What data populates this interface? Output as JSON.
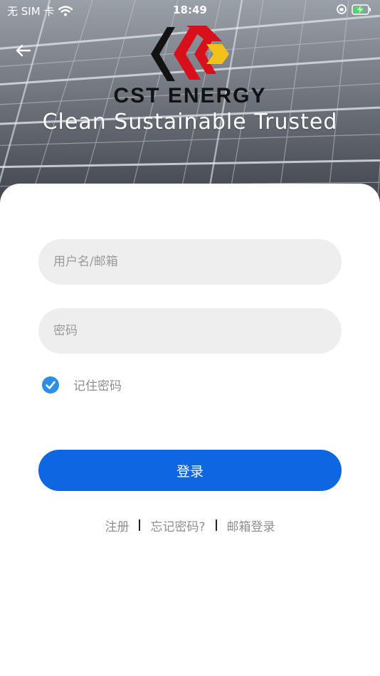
{
  "status_bar": {
    "carrier": "无 SIM 卡",
    "time": "18:49"
  },
  "brand": {
    "name": "CST ENERGY",
    "tagline": "Clean Sustainable Trusted",
    "colors": {
      "red": "#d8101c",
      "yellow": "#f2c21b",
      "black": "#121212"
    }
  },
  "form": {
    "username_placeholder": "用户名/邮箱",
    "password_placeholder": "密码",
    "remember_label": "记住密码",
    "remember_checked": true,
    "login_label": "登录"
  },
  "links": {
    "register": "注册",
    "forgot": "忘记密码?",
    "email_login": "邮箱登录"
  },
  "colors": {
    "primary": "#0e66e0",
    "check": "#2b8fe8",
    "input_bg": "#eeeeee"
  }
}
